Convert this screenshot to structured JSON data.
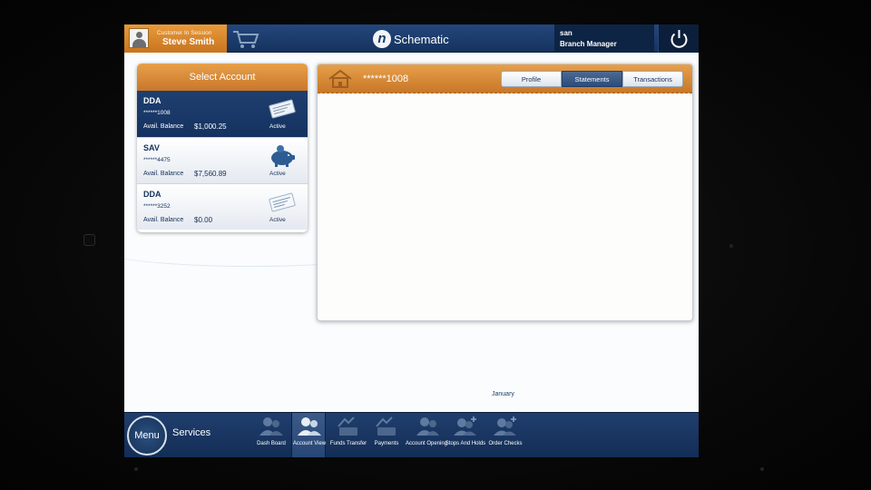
{
  "header": {
    "session_label": "Customer In Session",
    "customer_name": "Steve Smith",
    "brand_name": "Schematic",
    "user_name": "san",
    "user_role": "Branch Manager"
  },
  "accounts_panel": {
    "title": "Select Account",
    "items": [
      {
        "type": "DDA",
        "number": "******1008",
        "balance_label": "Avail. Balance",
        "balance": "$1,000.25",
        "status": "Active",
        "icon": "check-card-icon"
      },
      {
        "type": "SAV",
        "number": "******4475",
        "balance_label": "Avail. Balance",
        "balance": "$7,560.89",
        "status": "Active",
        "icon": "piggy-bank-icon"
      },
      {
        "type": "DDA",
        "number": "******3252",
        "balance_label": "Avail. Balance",
        "balance": "$0.00",
        "status": "Active",
        "icon": "check-card-icon"
      }
    ]
  },
  "detail": {
    "account_number": "******1008",
    "tabs": [
      {
        "label": "Profile",
        "active": false
      },
      {
        "label": "Statements",
        "active": true
      },
      {
        "label": "Transactions",
        "active": false
      }
    ],
    "month_label": "January"
  },
  "bottom_bar": {
    "menu_label": "Menu",
    "section_label": "Services",
    "items": [
      {
        "label": "Dash Board",
        "active": false
      },
      {
        "label": "Account View",
        "active": true
      },
      {
        "label": "Funds Transfer",
        "active": false
      },
      {
        "label": "Payments",
        "active": false
      },
      {
        "label": "Account Opening",
        "active": false
      },
      {
        "label": "Stops And Holds",
        "active": false
      },
      {
        "label": "Order Checks",
        "active": false
      }
    ]
  },
  "colors": {
    "navy": "#1b3c6c",
    "orange": "#d9852f",
    "panel_bg": "#fafcfd"
  }
}
